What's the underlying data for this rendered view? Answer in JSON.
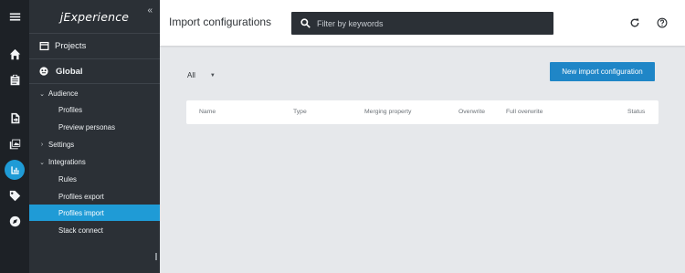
{
  "rail": {
    "icons": [
      "menu-icon",
      "home-icon",
      "clipboard-icon",
      "import-icon",
      "gallery-icon",
      "chart-icon",
      "tag-icon",
      "compass-icon"
    ],
    "active_index": 5
  },
  "sidebar": {
    "brand": "jExperience",
    "collapse": "«",
    "projects_label": "Projects",
    "site_label": "Global",
    "items": [
      {
        "label": "Audience",
        "expanded": true
      },
      {
        "label": "Profiles"
      },
      {
        "label": "Preview personas"
      },
      {
        "label": "Settings",
        "expanded": false
      },
      {
        "label": "Integrations",
        "expanded": true
      },
      {
        "label": "Rules"
      },
      {
        "label": "Profiles export"
      },
      {
        "label": "Profiles import",
        "selected": true
      },
      {
        "label": "Stack connect"
      }
    ]
  },
  "header": {
    "title": "Import configurations",
    "search_placeholder": "Filter by keywords"
  },
  "content": {
    "filter_value": "All",
    "new_button": "New import configuration",
    "columns": [
      "Name",
      "Type",
      "Merging property",
      "Overwrite",
      "Full overwrite",
      "Status"
    ]
  },
  "colors": {
    "accent": "#1f9bd6",
    "button": "#1f86c7",
    "sidebar": "#2b3036",
    "rail": "#1d2126",
    "background": "#e6e8eb"
  }
}
